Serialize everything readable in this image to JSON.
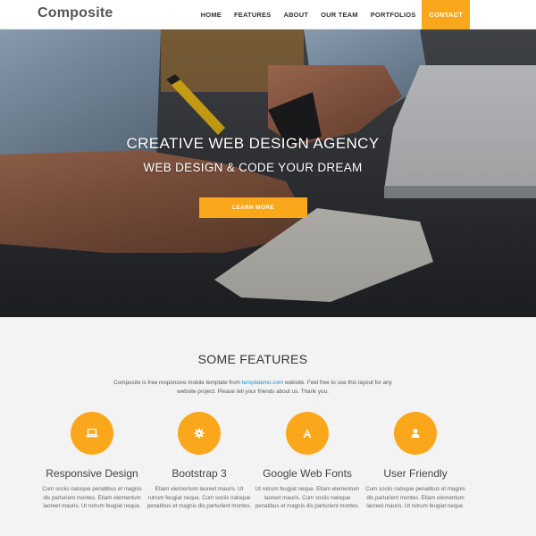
{
  "navbar": {
    "brand": "Composite",
    "items": [
      {
        "label": "HOME"
      },
      {
        "label": "FEATURES"
      },
      {
        "label": "ABOUT"
      },
      {
        "label": "OUR TEAM"
      },
      {
        "label": "PORTFOLIOS"
      },
      {
        "label": "CONTACT",
        "active": true
      }
    ]
  },
  "hero": {
    "title": "CREATIVE WEB DESIGN AGENCY",
    "subtitle": "WEB DESIGN & CODE YOUR DREAM",
    "button_label": "LEARN MORE"
  },
  "features": {
    "title": "SOME FEATURES",
    "intro_before": "Composite is free responsive mobile template from ",
    "intro_link": "templatemo.com",
    "intro_after": " website. Feel free to use this layout for any website project. Please tell your friends about us. Thank you.",
    "items": [
      {
        "icon": "laptop-icon",
        "title": "Responsive Design",
        "text": "Cum sociis natoque penatibus et magnis dis parturient montes. Etiam elementum laoreet mauris. Ut rutrum feugiat neque."
      },
      {
        "icon": "gear-icon",
        "title": "Bootstrap 3",
        "text": "Etiam elementum laoreet mauris. Ut rutrum feugiat neque. Cum sociis natoque penatibus et magnis dis parturient montes."
      },
      {
        "icon": "font-icon",
        "title": "Google Web Fonts",
        "text": "Ut rutrum feugiat neque. Etiam elementum laoreet mauris. Cum sociis natoque penatibus et magnis dis parturient montes."
      },
      {
        "icon": "user-icon",
        "title": "User Friendly",
        "text": "Cum sociis natoque penatibus et magnis dis parturient montes. Etiam elementum laoreet mauris. Ut rutrum feugiat neque."
      }
    ]
  },
  "colors": {
    "accent": "#fba71b",
    "link": "#1a8fd6",
    "features_bg": "#f3f3f3"
  }
}
